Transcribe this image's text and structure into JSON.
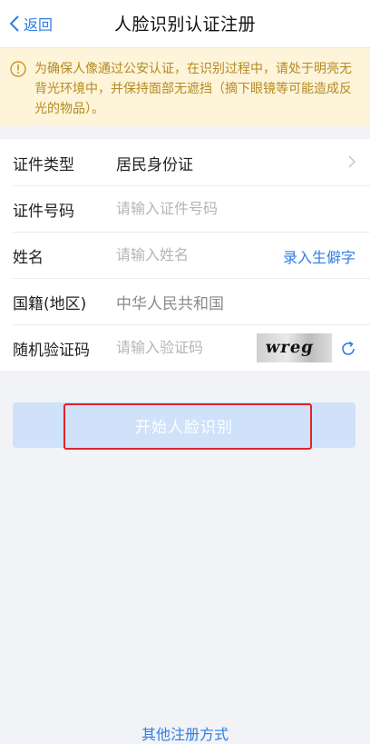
{
  "navbar": {
    "back_label": "返回",
    "title": "人脸识别认证注册"
  },
  "notice": {
    "text": "为确保人像通过公安认证，在识别过程中，请处于明亮无背光环境中，并保持面部无遮挡（摘下眼镜等可能造成反光的物品）。"
  },
  "form": {
    "id_type": {
      "label": "证件类型",
      "value": "居民身份证"
    },
    "id_number": {
      "label": "证件号码",
      "placeholder": "请输入证件号码"
    },
    "name": {
      "label": "姓名",
      "placeholder": "请输入姓名",
      "rare_char_link": "录入生僻字"
    },
    "nationality": {
      "label": "国籍(地区)",
      "value": "中华人民共和国"
    },
    "captcha": {
      "label": "随机验证码",
      "placeholder": "请输入验证码",
      "image_text": "wreg"
    }
  },
  "start_button": "开始人脸识别",
  "other_methods_link": "其他注册方式",
  "colors": {
    "accent": "#2f7de1",
    "notice_bg": "#fdf4d9",
    "notice_text": "#b58a22",
    "button_disabled": "#cfe2fa",
    "highlight": "#e0242a"
  }
}
